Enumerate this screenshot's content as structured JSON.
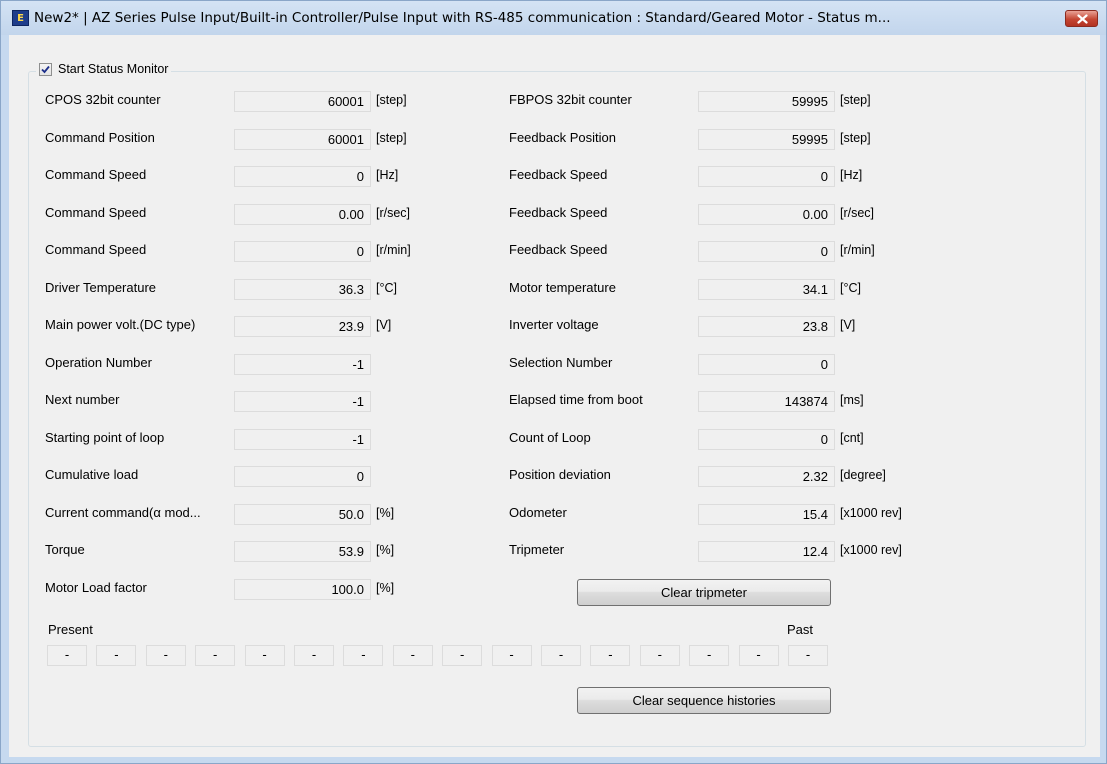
{
  "window": {
    "title": "New2* | AZ Series Pulse Input/Built-in Controller/Pulse Input with RS-485 communication : Standard/Geared Motor - Status m...",
    "icon": "app-icon"
  },
  "monitor": {
    "checkbox_label": "Start Status Monitor",
    "checked": true
  },
  "left": [
    {
      "label": "CPOS 32bit counter",
      "value": "60001",
      "unit": "[step]"
    },
    {
      "label": "Command Position",
      "value": "60001",
      "unit": "[step]"
    },
    {
      "label": "Command Speed",
      "value": "0",
      "unit": "[Hz]"
    },
    {
      "label": "Command Speed",
      "value": "0.00",
      "unit": "[r/sec]"
    },
    {
      "label": "Command Speed",
      "value": "0",
      "unit": "[r/min]"
    },
    {
      "label": "Driver Temperature",
      "value": "36.3",
      "unit": "[°C]"
    },
    {
      "label": "Main power volt.(DC type)",
      "value": "23.9",
      "unit": "[V]"
    },
    {
      "label": "Operation Number",
      "value": "-1",
      "unit": ""
    },
    {
      "label": "Next number",
      "value": "-1",
      "unit": ""
    },
    {
      "label": "Starting point of loop",
      "value": "-1",
      "unit": ""
    },
    {
      "label": "Cumulative load",
      "value": "0",
      "unit": ""
    },
    {
      "label": "Current  command(α mod...",
      "value": "50.0",
      "unit": "[%]"
    },
    {
      "label": "Torque",
      "value": "53.9",
      "unit": "[%]"
    },
    {
      "label": "Motor Load factor",
      "value": "100.0",
      "unit": "[%]"
    }
  ],
  "right": [
    {
      "label": "FBPOS 32bit counter",
      "value": "59995",
      "unit": "[step]"
    },
    {
      "label": "Feedback Position",
      "value": "59995",
      "unit": "[step]"
    },
    {
      "label": "Feedback Speed",
      "value": "0",
      "unit": "[Hz]"
    },
    {
      "label": "Feedback Speed",
      "value": "0.00",
      "unit": "[r/sec]"
    },
    {
      "label": "Feedback Speed",
      "value": "0",
      "unit": "[r/min]"
    },
    {
      "label": "Motor temperature",
      "value": "34.1",
      "unit": "[°C]"
    },
    {
      "label": "Inverter voltage",
      "value": "23.8",
      "unit": "[V]"
    },
    {
      "label": "Selection Number",
      "value": "0",
      "unit": ""
    },
    {
      "label": "Elapsed time from boot",
      "value": "143874",
      "unit": "[ms]"
    },
    {
      "label": "Count of Loop",
      "value": "0",
      "unit": "[cnt]"
    },
    {
      "label": "Position deviation",
      "value": "2.32",
      "unit": "[degree]"
    },
    {
      "label": "Odometer",
      "value": "15.4",
      "unit": "[x1000 rev]"
    },
    {
      "label": "Tripmeter",
      "value": "12.4",
      "unit": "[x1000 rev]"
    }
  ],
  "buttons": {
    "clear_tripmeter": "Clear tripmeter",
    "clear_sequence_histories": "Clear sequence histories"
  },
  "history": {
    "present_label": "Present",
    "past_label": "Past",
    "items": [
      "-",
      "-",
      "-",
      "-",
      "-",
      "-",
      "-",
      "-",
      "-",
      "-",
      "-",
      "-",
      "-",
      "-",
      "-",
      "-"
    ]
  }
}
